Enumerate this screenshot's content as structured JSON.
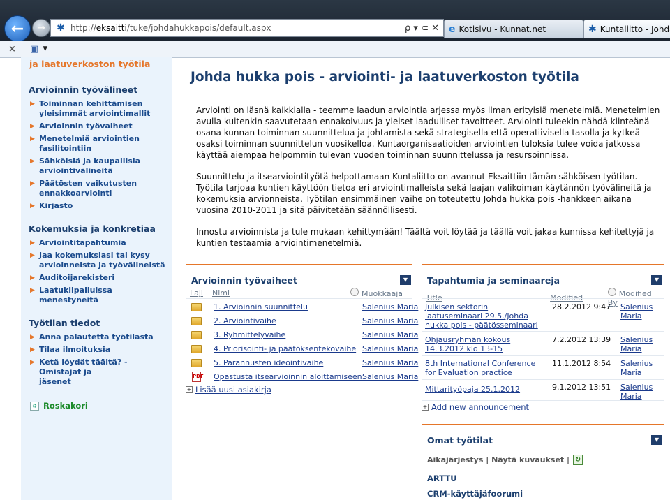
{
  "browser": {
    "url_prefix": "http://",
    "url_host": "eksaitti",
    "url_path": "/tuke/johdahukkapois/default.aspx",
    "address_controls": "ρ ▾ ⊂ ✕",
    "tabs": [
      {
        "label": "Kotisivu - Kunnat.net"
      },
      {
        "label": "Kuntaliitto - Johda"
      }
    ],
    "cmd_close": "×"
  },
  "sidebar": {
    "top_label": "ja laatuverkoston työtila",
    "sections": [
      {
        "heading": "Arvioinnin työvälineet",
        "items": [
          "Toiminnan kehittämisen\nyleisimmät arviointimallit",
          "Arvioinnin työvaiheet",
          "Menetelmiä arviointien\nfasilitointiin",
          "Sähköisiä ja kaupallisia\narviointivälineitä",
          "Päätösten vaikutusten\nennakkoarviointi",
          "Kirjasto"
        ]
      },
      {
        "heading": "Kokemuksia ja konkretiaa",
        "items": [
          "Arviointitapahtumia",
          "Jaa kokemuksiasi tai kysy\narvioinneista ja työvälineistä",
          "Auditoijarekisteri",
          "Laatukilpailuissa menestyneitä"
        ]
      },
      {
        "heading": "Työtilan tiedot",
        "items": [
          "Anna palautetta työtilasta",
          "Tilaa ilmoituksia",
          "Ketä löydät täältä? - Omistajat ja\njäsenet"
        ]
      }
    ],
    "recycle_bin": "Roskakori"
  },
  "main": {
    "title": "Johda hukka pois - arviointi- ja laatuverkoston työtila",
    "paragraphs": [
      "Arviointi on läsnä kaikkialla - teemme laadun arviointia arjessa myös ilman erityisiä menetelmiä. Menetelmien avulla kuitenkin saavutetaan ennakoivuus ja yleiset laadulliset tavoitteet. Arviointi tuleekin nähdä kiinteänä osana kunnan toiminnan suunnittelua ja johtamista sekä strategisella että operatiivisella tasolla ja kytkeä osaksi toiminnan suunnittelun vuosikelloa. Kuntaorganisaatioiden arviointien tuloksia tulee voida jatkossa käyttää aiempaa helpommin tulevan vuoden toiminnan suunnittelussa ja resursoinnissa.",
      "Suunnittelu ja itsearviointityötä helpottamaan Kuntaliitto on avannut Eksaittiin tämän sähköisen työtilan. Työtila tarjoaa kuntien käyttöön tietoa eri arviointimalleista sekä laajan valikoiman käytännön työvälineitä ja kokemuksia arvionneista. Työtilan ensimmäinen vaihe on toteutettu Johda hukka pois -hankkeen aikana vuosina 2010-2011 ja sitä päivitetään säännöllisesti.",
      "Innostu arvioinnista ja tule mukaan kehittymään! Täältä voit löytää ja täällä voit jakaa kunnissa kehitettyjä ja kuntien testaamia arviointimenetelmiä."
    ]
  },
  "documents": {
    "title": "Arvioinnin työvaiheet",
    "columns": {
      "type": "Laji",
      "name": "Nimi",
      "modified_by": "Muokkaaja"
    },
    "rows": [
      {
        "icon": "folder",
        "name": "1. Arvioinnin suunnittelu",
        "by": "Salenius Maria"
      },
      {
        "icon": "folder",
        "name": "2. Arviointivaihe",
        "by": "Salenius Maria"
      },
      {
        "icon": "folder",
        "name": "3. Ryhmittelyvaihe",
        "by": "Salenius Maria"
      },
      {
        "icon": "folder",
        "name": "4. Priorisointi- ja päätöksentekovaihe",
        "by": "Salenius Maria"
      },
      {
        "icon": "folder",
        "name": "5. Parannusten ideointivaihe",
        "by": "Salenius Maria"
      },
      {
        "icon": "pdf",
        "name": "Opastusta itsearvioinnin aloittamiseen",
        "by": "Salenius Maria"
      }
    ],
    "add_link": "Lisää uusi asiakirja"
  },
  "events": {
    "title": "Tapahtumia ja seminaareja",
    "columns": {
      "title": "Title",
      "modified": "Modified",
      "modified_by": "Modified By"
    },
    "rows": [
      {
        "title": "Julkisen sektorin laatuseminaari 29.5./Johda hukka pois - päätösseminaari",
        "modified": "28.2.2012 9:47",
        "by": "Salenius Maria"
      },
      {
        "title": "Ohjausryhmän kokous 14.3.2012 klo 13-15",
        "modified": "7.2.2012 13:39",
        "by": "Salenius Maria"
      },
      {
        "title": "8th International Conference for Evaluation practice",
        "modified": "11.1.2012 8:54",
        "by": "Salenius Maria"
      },
      {
        "title": "Mittarityöpaja 25.1.2012",
        "modified": "9.1.2012 13:51",
        "by": "Salenius Maria"
      }
    ],
    "add_link": "Add new announcement"
  },
  "workspaces": {
    "title": "Omat työtilat",
    "toolbar": "Aikajärjestys | Näytä kuvaukset |",
    "items": [
      "ARTTU",
      "CRM-käyttäjäfoorumi"
    ]
  }
}
